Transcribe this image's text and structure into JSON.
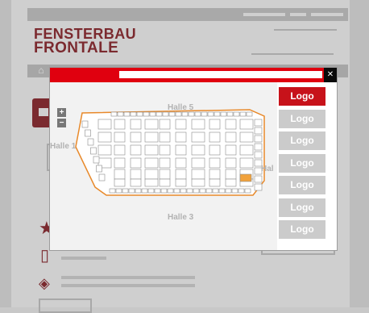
{
  "brand": {
    "line1": "FENSTERBAU",
    "line2": "FRONTALE",
    "color": "#7b2a2f"
  },
  "modal": {
    "close_icon": "close-icon",
    "accent": "#e0000f"
  },
  "map": {
    "zoom_in": "+",
    "zoom_out": "−",
    "hall_labels": {
      "top": "Halle 5",
      "left": "Halle 1",
      "right": "Hal",
      "bottom": "Halle 3"
    },
    "outline_color": "#e8892a",
    "highlight_color": "#f1a23c"
  },
  "logos": [
    "Logo",
    "Logo",
    "Logo",
    "Logo",
    "Logo",
    "Logo",
    "Logo"
  ],
  "icons": {
    "home": "home-icon",
    "star": "star-icon",
    "phone": "phone-icon",
    "ticket": "ticket-icon"
  }
}
